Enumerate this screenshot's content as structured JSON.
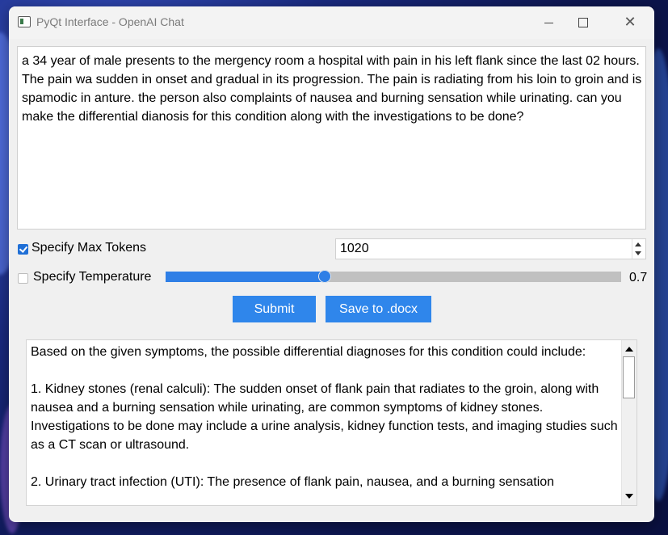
{
  "window": {
    "title": "PyQt Interface - OpenAI Chat"
  },
  "prompt": {
    "text": "a 34 year of male presents to the mergency room a hospital with pain in his left flank since the last 02 hours. The pain wa sudden in onset and gradual in its progression. The pain is radiating from his loin to groin and is spamodic in anture. the person also complaints of nausea and burning sensation while urinating. can you make the differential dianosis for this condition along with the investigations to be done?"
  },
  "max_tokens": {
    "label": "Specify Max Tokens",
    "checked": true,
    "value": "1020"
  },
  "temperature": {
    "label": "Specify Temperature",
    "checked": false,
    "value": 0.7,
    "value_label": "0.7",
    "fill_fraction": 0.35
  },
  "buttons": {
    "submit": "Submit",
    "save": "Save to .docx"
  },
  "response": {
    "text": "Based on the given symptoms, the possible differential diagnoses for this condition could include:\n\n1. Kidney stones (renal calculi): The sudden onset of flank pain that radiates to the groin, along with nausea and a burning sensation while urinating, are common symptoms of kidney stones. Investigations to be done may include a urine analysis, kidney function tests, and imaging studies such as a CT scan or ultrasound.\n\n2. Urinary tract infection (UTI): The presence of flank pain, nausea, and a burning sensation"
  },
  "colors": {
    "accent": "#2f86eb",
    "slider_fill": "#2f7fe6",
    "slider_track": "#c0c0c0"
  }
}
